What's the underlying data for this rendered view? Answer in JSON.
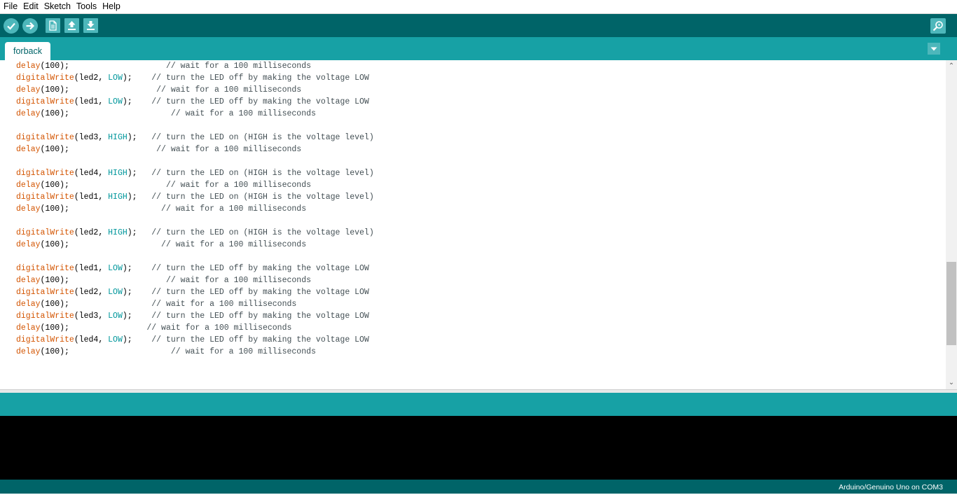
{
  "menu": [
    "File",
    "Edit",
    "Sketch",
    "Tools",
    "Help"
  ],
  "toolbar": {
    "buttons": [
      "verify-icon",
      "upload-icon",
      "new-icon",
      "open-icon",
      "save-icon"
    ],
    "serial_monitor": "magnifier-icon"
  },
  "tab": {
    "name": "forback"
  },
  "colors": {
    "toolbar": "#006468",
    "tabbar": "#17a1a5",
    "function": "#d35400",
    "constant": "#00979c",
    "comment": "#434f54"
  },
  "code_lines": [
    [
      [
        "fn",
        "delay"
      ],
      [
        "t",
        "(100);"
      ],
      [
        "cm",
        "                    // wait for a 100 milliseconds"
      ]
    ],
    [
      [
        "fn",
        "digitalWrite"
      ],
      [
        "t",
        "(led2, "
      ],
      [
        "kw",
        "LOW"
      ],
      [
        "t",
        ");"
      ],
      [
        "cm",
        "    // turn the LED off by making the voltage LOW"
      ]
    ],
    [
      [
        "fn",
        "delay"
      ],
      [
        "t",
        "(100);"
      ],
      [
        "cm",
        "                  // wait for a 100 milliseconds"
      ]
    ],
    [
      [
        "fn",
        "digitalWrite"
      ],
      [
        "t",
        "(led1, "
      ],
      [
        "kw",
        "LOW"
      ],
      [
        "t",
        ");"
      ],
      [
        "cm",
        "    // turn the LED off by making the voltage LOW"
      ]
    ],
    [
      [
        "fn",
        "delay"
      ],
      [
        "t",
        "(100);"
      ],
      [
        "cm",
        "                     // wait for a 100 milliseconds"
      ]
    ],
    [],
    [
      [
        "fn",
        "digitalWrite"
      ],
      [
        "t",
        "(led3, "
      ],
      [
        "kw",
        "HIGH"
      ],
      [
        "t",
        ");"
      ],
      [
        "cm",
        "   // turn the LED on (HIGH is the voltage level)"
      ]
    ],
    [
      [
        "fn",
        "delay"
      ],
      [
        "t",
        "(100);"
      ],
      [
        "cm",
        "                  // wait for a 100 milliseconds"
      ]
    ],
    [],
    [
      [
        "fn",
        "digitalWrite"
      ],
      [
        "t",
        "(led4, "
      ],
      [
        "kw",
        "HIGH"
      ],
      [
        "t",
        ");"
      ],
      [
        "cm",
        "   // turn the LED on (HIGH is the voltage level)"
      ]
    ],
    [
      [
        "fn",
        "delay"
      ],
      [
        "t",
        "(100);"
      ],
      [
        "cm",
        "                    // wait for a 100 milliseconds"
      ]
    ],
    [
      [
        "fn",
        "digitalWrite"
      ],
      [
        "t",
        "(led1, "
      ],
      [
        "kw",
        "HIGH"
      ],
      [
        "t",
        ");"
      ],
      [
        "cm",
        "   // turn the LED on (HIGH is the voltage level)"
      ]
    ],
    [
      [
        "fn",
        "delay"
      ],
      [
        "t",
        "(100);"
      ],
      [
        "cm",
        "                   // wait for a 100 milliseconds"
      ]
    ],
    [],
    [
      [
        "fn",
        "digitalWrite"
      ],
      [
        "t",
        "(led2, "
      ],
      [
        "kw",
        "HIGH"
      ],
      [
        "t",
        ");"
      ],
      [
        "cm",
        "   // turn the LED on (HIGH is the voltage level)"
      ]
    ],
    [
      [
        "fn",
        "delay"
      ],
      [
        "t",
        "(100);"
      ],
      [
        "cm",
        "                   // wait for a 100 milliseconds"
      ]
    ],
    [],
    [
      [
        "fn",
        "digitalWrite"
      ],
      [
        "t",
        "(led1, "
      ],
      [
        "kw",
        "LOW"
      ],
      [
        "t",
        ");"
      ],
      [
        "cm",
        "    // turn the LED off by making the voltage LOW"
      ]
    ],
    [
      [
        "fn",
        "delay"
      ],
      [
        "t",
        "(100);"
      ],
      [
        "cm",
        "                    // wait for a 100 milliseconds"
      ]
    ],
    [
      [
        "fn",
        "digitalWrite"
      ],
      [
        "t",
        "(led2, "
      ],
      [
        "kw",
        "LOW"
      ],
      [
        "t",
        ");"
      ],
      [
        "cm",
        "    // turn the LED off by making the voltage LOW"
      ]
    ],
    [
      [
        "fn",
        "delay"
      ],
      [
        "t",
        "(100);"
      ],
      [
        "cm",
        "                 // wait for a 100 milliseconds"
      ]
    ],
    [
      [
        "fn",
        "digitalWrite"
      ],
      [
        "t",
        "(led3, "
      ],
      [
        "kw",
        "LOW"
      ],
      [
        "t",
        ");"
      ],
      [
        "cm",
        "    // turn the LED off by making the voltage LOW"
      ]
    ],
    [
      [
        "fn",
        "delay"
      ],
      [
        "t",
        "(100);"
      ],
      [
        "cm",
        "                // wait for a 100 milliseconds"
      ]
    ],
    [
      [
        "fn",
        "digitalWrite"
      ],
      [
        "t",
        "(led4, "
      ],
      [
        "kw",
        "LOW"
      ],
      [
        "t",
        ");"
      ],
      [
        "cm",
        "    // turn the LED off by making the voltage LOW"
      ]
    ],
    [
      [
        "fn",
        "delay"
      ],
      [
        "t",
        "(100);"
      ],
      [
        "cm",
        "                     // wait for a 100 milliseconds"
      ]
    ]
  ],
  "editor_scroll": {
    "thumb_start_fraction": 0.62,
    "thumb_fraction": 0.27
  },
  "status": {
    "board": "Arduino/Genuino Uno on COM3"
  }
}
